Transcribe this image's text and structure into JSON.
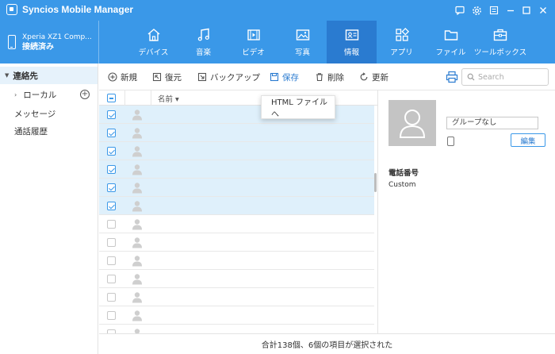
{
  "app": {
    "title": "Syncios Mobile Manager",
    "accent": "#3a98e8",
    "accent_dark": "#2a7bd0"
  },
  "window_controls": [
    "chat-icon",
    "gear-icon",
    "menu-icon",
    "minimize-icon",
    "maximize-icon",
    "close-icon"
  ],
  "device": {
    "name": "Xperia XZ1 Comp...",
    "status": "接続済み"
  },
  "nav": {
    "tabs": [
      {
        "label": "デバイス",
        "icon": "home-icon",
        "active": false
      },
      {
        "label": "音楽",
        "icon": "music-icon",
        "active": false
      },
      {
        "label": "ビデオ",
        "icon": "video-icon",
        "active": false
      },
      {
        "label": "写真",
        "icon": "photo-icon",
        "active": false
      },
      {
        "label": "情報",
        "icon": "contact-card-icon",
        "active": true
      },
      {
        "label": "アプリ",
        "icon": "apps-icon",
        "active": false
      },
      {
        "label": "ファイル",
        "icon": "folder-icon",
        "active": false
      },
      {
        "label": "ツールボックス",
        "icon": "toolbox-icon",
        "active": false
      }
    ]
  },
  "sidebar": {
    "contacts": "連絡先",
    "local": "ローカル",
    "messages": "メッセージ",
    "call_log": "通話履歴"
  },
  "toolbar": {
    "new": "新規",
    "restore": "復元",
    "backup": "バックアップ",
    "save": "保存",
    "delete": "削除",
    "refresh": "更新",
    "search_placeholder": "Search"
  },
  "save_menu": {
    "html": "HTML ファイルへ"
  },
  "table": {
    "name_header": "名前",
    "rows": [
      {
        "name": " ",
        "phone": " ",
        "selected": true
      },
      {
        "name": " ",
        "phone": " ",
        "selected": true
      },
      {
        "name": " ",
        "phone": " ",
        "selected": true
      },
      {
        "name": " ",
        "phone": " ",
        "selected": true
      },
      {
        "name": " ",
        "phone": " ",
        "selected": true
      },
      {
        "name": " ",
        "phone": " ",
        "selected": true
      },
      {
        "name": " ",
        "phone": " ",
        "selected": false
      },
      {
        "name": " ",
        "phone": " ",
        "selected": false
      },
      {
        "name": " ",
        "phone": " ",
        "selected": false
      },
      {
        "name": " ",
        "phone": " ",
        "selected": false
      },
      {
        "name": " ",
        "phone": " ",
        "selected": false
      },
      {
        "name": " ",
        "phone": " ",
        "selected": false
      },
      {
        "name": " ",
        "phone": " ",
        "selected": false
      }
    ]
  },
  "detail": {
    "name": " ",
    "group": "グループなし",
    "edit": "編集",
    "phone_heading": "電話番号",
    "custom_label": "Custom",
    "custom_value": " "
  },
  "status": {
    "text": "合計138個、6個の項目が選択された"
  }
}
